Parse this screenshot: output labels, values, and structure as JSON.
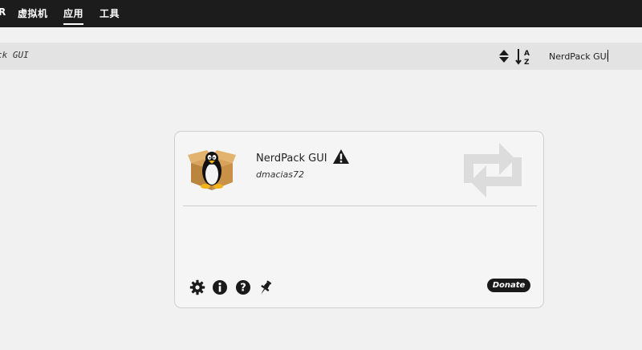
{
  "nav": {
    "items": [
      {
        "label": "R"
      },
      {
        "label": "虚拟机"
      },
      {
        "label": "应用",
        "active": true
      },
      {
        "label": "工具"
      }
    ]
  },
  "filterbar": {
    "breadcrumb": "ck GUI",
    "search_value": "NerdPack GUI"
  },
  "app": {
    "title": "NerdPack GUI",
    "author": "dmacias72",
    "donate_label": "Donate"
  },
  "icons": {
    "sort": "sort-icon",
    "az": "sort-alpha-icon",
    "warning": "warning-icon",
    "update": "update-available-icon",
    "settings": "gear-icon",
    "info": "info-icon",
    "help": "help-icon",
    "pin": "pin-icon"
  },
  "colors": {
    "nav_bg": "#1c1c1c",
    "page_bg": "#f1f1f1",
    "filterbar_bg": "#e3e3e3",
    "donate_bg": "#1a1a1a"
  }
}
